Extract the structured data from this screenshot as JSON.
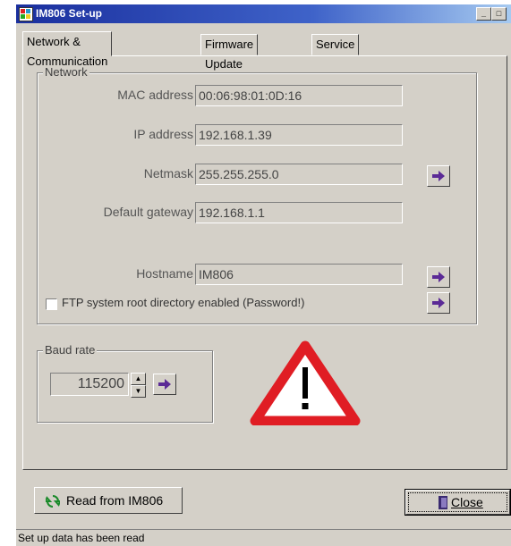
{
  "window": {
    "title": "IM806 Set-up"
  },
  "tabs": [
    {
      "label": "Network & Communication"
    },
    {
      "label": "Firmware Update"
    },
    {
      "label": "Service"
    }
  ],
  "network": {
    "legend": "Network",
    "mac_label": "MAC address",
    "mac_value": "00:06:98:01:0D:16",
    "ip_label": "IP address",
    "ip_value": "192.168.1.39",
    "netmask_label": "Netmask",
    "netmask_value": "255.255.255.0",
    "gateway_label": "Default gateway",
    "gateway_value": "192.168.1.1",
    "hostname_label": "Hostname",
    "hostname_value": "IM806",
    "ftp_label": "FTP system root directory enabled (Password!)"
  },
  "baud": {
    "legend": "Baud rate",
    "value": "115200"
  },
  "buttons": {
    "read_label": "Read from IM806",
    "close_label": "Close"
  },
  "status": {
    "text": "Set up data has been read"
  },
  "colors": {
    "arrow": "#5b2a96",
    "warning": "#e01d24",
    "title_bar": "#1a2f9e"
  }
}
